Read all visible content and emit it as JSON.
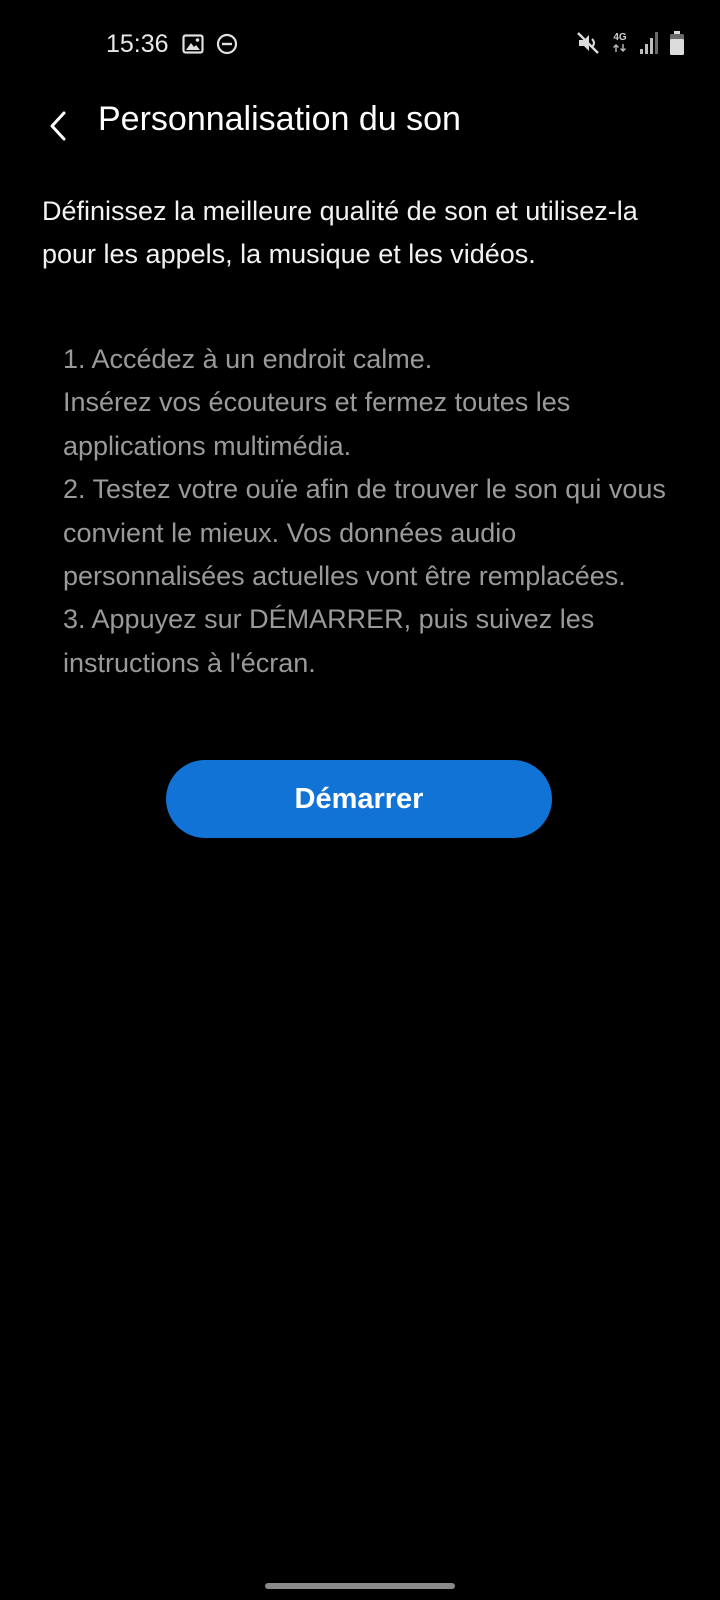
{
  "status_bar": {
    "time": "15:36",
    "network_label": "4G",
    "icons": [
      "image-icon",
      "do-not-disturb-icon",
      "mute-icon",
      "network-4g-icon",
      "signal-icon",
      "battery-icon"
    ]
  },
  "header": {
    "title": "Personnalisation du son"
  },
  "main": {
    "intro": "Définissez la meilleure qualité de son et utilisez-la pour les appels, la musique et les vidéos.",
    "steps": [
      "1. Accédez à un endroit calme.\nInsérez vos écouteurs et fermez toutes les applications multimédia.",
      "2. Testez votre ouïe afin de trouver le son qui vous convient le mieux. Vos données audio personnalisées actuelles vont être remplacées.",
      "3. Appuyez sur DÉMARRER, puis suivez les instructions à l'écran."
    ],
    "start_label": "Démarrer"
  },
  "colors": {
    "background": "#000000",
    "accent": "#1173d6",
    "secondary_text": "#9a9a9a"
  }
}
